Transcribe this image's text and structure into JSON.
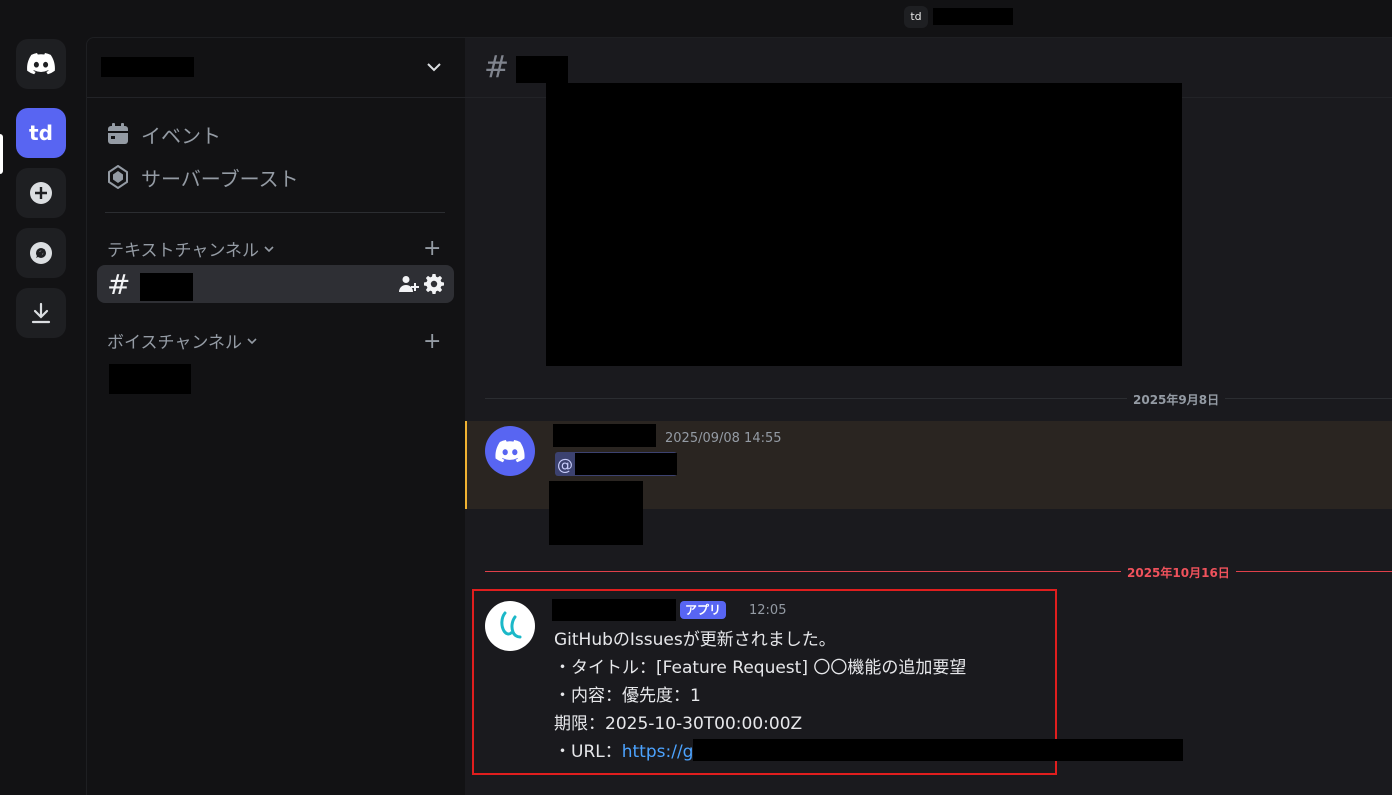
{
  "titlebar": {
    "server_badge": "td"
  },
  "rail": {
    "active_server": "td"
  },
  "sidebar": {
    "events_label": "イベント",
    "boost_label": "サーバーブースト",
    "text_category": "テキストチャンネル",
    "voice_category": "ボイスチャンネル"
  },
  "main": {
    "divider_1": "2025年9月8日",
    "divider_2": "2025年10月16日",
    "message_1": {
      "timestamp": "2025/09/08 14:55",
      "mention_prefix": "@"
    },
    "message_2": {
      "app_tag": "アプリ",
      "timestamp": "12:05",
      "lines": [
        "GitHubのIssuesが更新されました。",
        "・タイトル：[Feature Request] 〇〇機能の追加要望",
        "・内容：優先度：1",
        "期限：2025-10-30T00:00:00Z"
      ],
      "url_prefix": "・URL：",
      "url_text": "https://g"
    }
  },
  "colors": {
    "accent": "#5865f2",
    "new_divider": "#e0404a",
    "highlight_box": "#e01e1e",
    "mention_bar": "#f0b232"
  }
}
